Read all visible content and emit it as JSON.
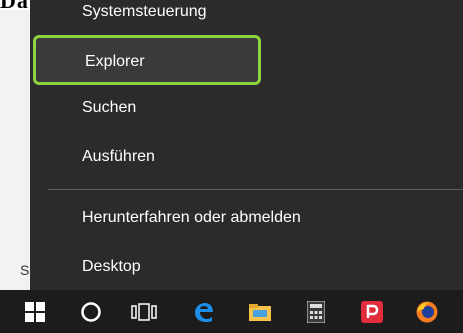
{
  "page": {
    "top_fragment": "Datei",
    "left_fragment": "S"
  },
  "menu": {
    "items": [
      {
        "label": "Systemsteuerung",
        "highlighted": false
      },
      {
        "label": "Explorer",
        "highlighted": true
      },
      {
        "label": "Suchen",
        "highlighted": false
      },
      {
        "label": "Ausführen",
        "highlighted": false
      },
      {
        "label": "Herunterfahren oder abmelden",
        "highlighted": false
      },
      {
        "label": "Desktop",
        "highlighted": false
      }
    ],
    "highlight_color": "#8dd23f",
    "background_color": "#2b2b2b"
  },
  "taskbar": {
    "icons": [
      "windows-start-icon",
      "cortana-circle-icon",
      "task-view-icon",
      "edge-browser-icon",
      "file-explorer-icon",
      "calculator-icon",
      "pdf-app-icon",
      "firefox-icon"
    ]
  }
}
